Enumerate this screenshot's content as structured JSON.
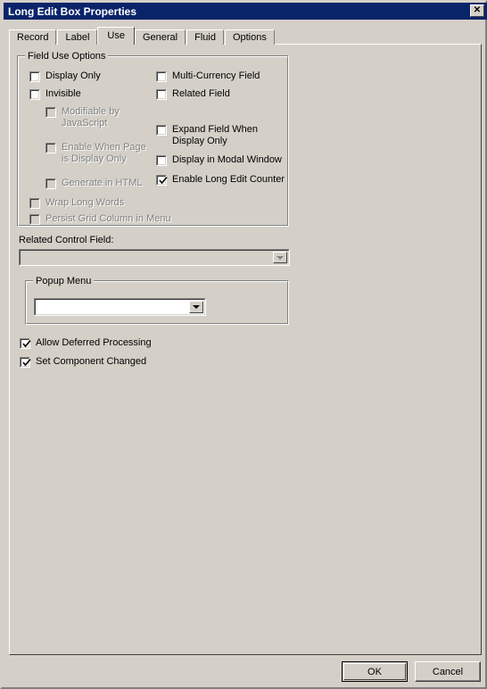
{
  "window": {
    "title": "Long Edit Box Properties",
    "close_label": "✕"
  },
  "tabs": [
    {
      "label": "Record",
      "selected": false
    },
    {
      "label": "Label",
      "selected": false
    },
    {
      "label": "Use",
      "selected": true
    },
    {
      "label": "General",
      "selected": false
    },
    {
      "label": "Fluid",
      "selected": false
    },
    {
      "label": "Options",
      "selected": false
    }
  ],
  "field_use_options": {
    "title": "Field Use Options",
    "left_column": [
      {
        "label": "Display Only",
        "checked": false,
        "enabled": true
      },
      {
        "label": "Invisible",
        "checked": false,
        "enabled": true
      },
      {
        "label": "Modifiable by\nJavaScript",
        "checked": false,
        "enabled": false
      },
      {
        "label": "Enable When Page\nis Display Only",
        "checked": false,
        "enabled": false
      },
      {
        "label": "Generate in HTML",
        "checked": false,
        "enabled": false
      },
      {
        "label": "Wrap Long Words",
        "checked": false,
        "enabled": false
      },
      {
        "label": "Persist Grid Column in Menu",
        "checked": false,
        "enabled": false
      }
    ],
    "right_column": [
      {
        "label": "Multi-Currency Field",
        "checked": false,
        "enabled": true
      },
      {
        "label": "Related Field",
        "checked": false,
        "enabled": true
      },
      {
        "label": "Expand Field When\nDisplay Only",
        "checked": false,
        "enabled": true
      },
      {
        "label": "Display in Modal Window",
        "checked": false,
        "enabled": true
      },
      {
        "label": "Enable Long Edit Counter",
        "checked": true,
        "enabled": true
      }
    ]
  },
  "related_control_field": {
    "label": "Related Control Field:",
    "value": "",
    "enabled": false
  },
  "popup_menu": {
    "title": "Popup Menu",
    "value": "",
    "enabled": true
  },
  "bottom_options": [
    {
      "label": "Allow Deferred Processing",
      "checked": true,
      "enabled": true
    },
    {
      "label": "Set Component Changed",
      "checked": true,
      "enabled": true
    }
  ],
  "buttons": {
    "ok": "OK",
    "cancel": "Cancel"
  },
  "colors": {
    "titlebar": "#0a246a",
    "face": "#d4d0c8",
    "disabled_text": "#808080"
  }
}
